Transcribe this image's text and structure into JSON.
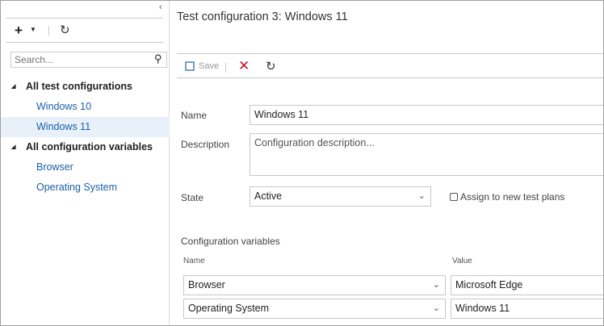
{
  "left": {
    "search_placeholder": "Search...",
    "tree": [
      {
        "label": "All test configurations",
        "children": [
          "Windows 10",
          "Windows 11"
        ]
      },
      {
        "label": "All configuration variables",
        "children": [
          "Browser",
          "Operating System"
        ]
      }
    ],
    "selected": "Windows 11"
  },
  "right": {
    "title": "Test configuration 3: Windows 11",
    "toolbar": {
      "save_label": "Save"
    },
    "form": {
      "name_label": "Name",
      "name_value": "Windows 11",
      "description_label": "Description",
      "description_placeholder": "Configuration description...",
      "state_label": "State",
      "state_value": "Active",
      "assign_label": "Assign to new test plans",
      "assign_checked": false,
      "variables_label": "Configuration variables",
      "col_name": "Name",
      "col_value": "Value",
      "variables": [
        {
          "name": "Browser",
          "value": "Microsoft Edge"
        },
        {
          "name": "Operating System",
          "value": "Windows 11"
        }
      ]
    }
  },
  "colors": {
    "link": "#1a5fa8",
    "delete": "#c8102e",
    "selected_bg": "#e8f0fa"
  }
}
